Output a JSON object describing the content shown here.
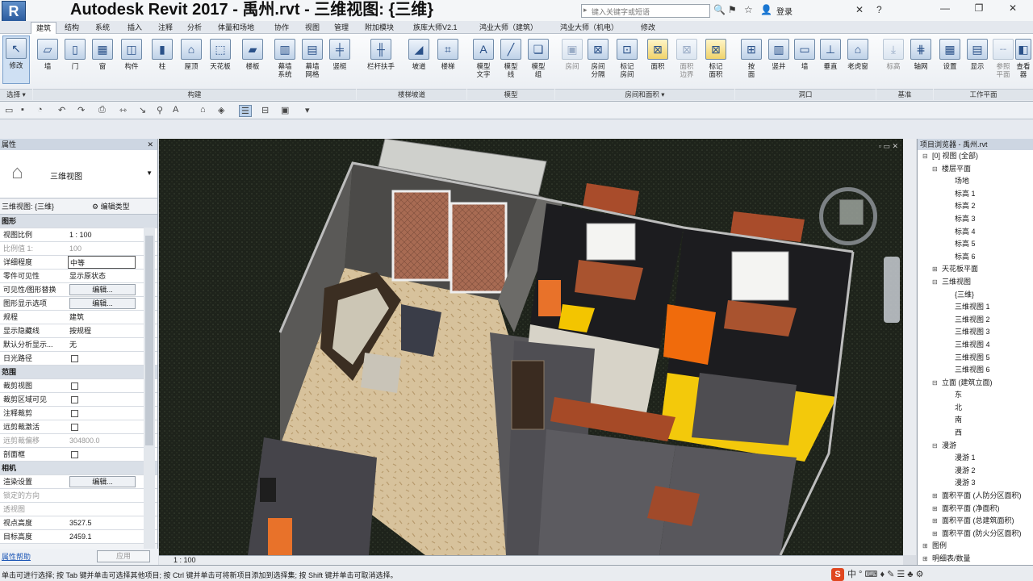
{
  "title_bar": {
    "app_logo": "R",
    "window_title": "Autodesk Revit 2017 -     禹州.rvt - 三维视图: {三维}",
    "search_placeholder": "键入关键字或短语",
    "sign_in": "登录",
    "window_controls": [
      "—",
      "❐",
      "✕"
    ]
  },
  "ribbon_tabs": [
    "建筑",
    "结构",
    "系统",
    "插入",
    "注释",
    "分析",
    "体量和场地",
    "协作",
    "视图",
    "管理",
    "附加模块",
    "族库大师V2.1",
    "鸿业大师（建筑）",
    "鸿业大师（机电）",
    "修改"
  ],
  "ribbon": {
    "modify_label": "修改",
    "build_buttons": [
      "墙",
      "门",
      "窗",
      "构件",
      "柱",
      "屋顶",
      "天花板",
      "楼板",
      "幕墙\n系统",
      "幕墙\n网格",
      "竖梃"
    ],
    "circulation_buttons": [
      "栏杆扶手",
      "坡道",
      "楼梯"
    ],
    "model_buttons": [
      "模型\n文字",
      "模型\n线",
      "模型\n组"
    ],
    "room_buttons": [
      "房间",
      "房间\n分隔",
      "标记\n房间",
      "面积",
      "面积\n边界",
      "标记\n面积"
    ],
    "opening_buttons": [
      "按\n面",
      "竖井",
      "墙",
      "垂直",
      "老虎窗"
    ],
    "datum_buttons": [
      "标高",
      "轴网"
    ],
    "workplane_buttons": [
      "设置",
      "显示",
      "参照\n平面",
      "查看器"
    ],
    "panels": {
      "select": "选择 ▾",
      "build": "构建",
      "circulation": "楼梯坡道",
      "model": "模型",
      "room": "房间和面积 ▾",
      "opening": "洞口",
      "datum": "基准",
      "workplane": "工作平面"
    }
  },
  "properties": {
    "header": "属性",
    "close": "✕",
    "type_name": "三维视图",
    "instance_selector": "三维视图: {三维}",
    "edit_type": "编辑类型",
    "rows": [
      {
        "k": "图形",
        "v": "",
        "kind": "grp"
      },
      {
        "k": "视图比例",
        "v": "1 : 100",
        "kind": "text"
      },
      {
        "k": "比例值 1:",
        "v": "100",
        "kind": "dis"
      },
      {
        "k": "详细程度",
        "v": "中等",
        "kind": "box"
      },
      {
        "k": "零件可见性",
        "v": "显示原状态",
        "kind": "text"
      },
      {
        "k": "可见性/图形替换",
        "v": "编辑...",
        "kind": "btn"
      },
      {
        "k": "图形显示选项",
        "v": "编辑...",
        "kind": "btn"
      },
      {
        "k": "规程",
        "v": "建筑",
        "kind": "text"
      },
      {
        "k": "显示隐藏线",
        "v": "按规程",
        "kind": "text"
      },
      {
        "k": "默认分析显示...",
        "v": "无",
        "kind": "text"
      },
      {
        "k": "日光路径",
        "v": "",
        "kind": "chk"
      },
      {
        "k": "范围",
        "v": "",
        "kind": "grp"
      },
      {
        "k": "裁剪视图",
        "v": "",
        "kind": "chk"
      },
      {
        "k": "裁剪区域可见",
        "v": "",
        "kind": "chk"
      },
      {
        "k": "注释裁剪",
        "v": "",
        "kind": "chk"
      },
      {
        "k": "远剪裁激活",
        "v": "",
        "kind": "chk"
      },
      {
        "k": "远剪裁偏移",
        "v": "304800.0",
        "kind": "dis"
      },
      {
        "k": "剖面框",
        "v": "",
        "kind": "chk"
      },
      {
        "k": "相机",
        "v": "",
        "kind": "grp"
      },
      {
        "k": "渲染设置",
        "v": "编辑...",
        "kind": "btn"
      },
      {
        "k": "锁定的方向",
        "v": "",
        "kind": "dis"
      },
      {
        "k": "透视图",
        "v": "",
        "kind": "dis"
      },
      {
        "k": "视点高度",
        "v": "3527.5",
        "kind": "text"
      },
      {
        "k": "目标高度",
        "v": "2459.1",
        "kind": "text"
      }
    ],
    "help_link": "属性帮助",
    "apply": "应用"
  },
  "viewport": {
    "scale": "1 : 100",
    "controls": "▫ ▭ ✕"
  },
  "project_browser": {
    "header": "项目浏览器 - 禹州.rvt",
    "nodes": [
      {
        "l": "[0] 视图 (全部)",
        "d": 0,
        "t": "⊟"
      },
      {
        "l": "楼层平面",
        "d": 1,
        "t": "⊟"
      },
      {
        "l": "场地",
        "d": 2,
        "t": ""
      },
      {
        "l": "标高 1",
        "d": 2,
        "t": ""
      },
      {
        "l": "标高 2",
        "d": 2,
        "t": ""
      },
      {
        "l": "标高 3",
        "d": 2,
        "t": ""
      },
      {
        "l": "标高 4",
        "d": 2,
        "t": ""
      },
      {
        "l": "标高 5",
        "d": 2,
        "t": ""
      },
      {
        "l": "标高 6",
        "d": 2,
        "t": ""
      },
      {
        "l": "天花板平面",
        "d": 1,
        "t": "⊞"
      },
      {
        "l": "三维视图",
        "d": 1,
        "t": "⊟"
      },
      {
        "l": "{三维}",
        "d": 2,
        "t": ""
      },
      {
        "l": "三维视图 1",
        "d": 2,
        "t": ""
      },
      {
        "l": "三维视图 2",
        "d": 2,
        "t": ""
      },
      {
        "l": "三维视图 3",
        "d": 2,
        "t": ""
      },
      {
        "l": "三维视图 4",
        "d": 2,
        "t": ""
      },
      {
        "l": "三维视图 5",
        "d": 2,
        "t": ""
      },
      {
        "l": "三维视图 6",
        "d": 2,
        "t": ""
      },
      {
        "l": "立面 (建筑立面)",
        "d": 1,
        "t": "⊟"
      },
      {
        "l": "东",
        "d": 2,
        "t": ""
      },
      {
        "l": "北",
        "d": 2,
        "t": ""
      },
      {
        "l": "南",
        "d": 2,
        "t": ""
      },
      {
        "l": "西",
        "d": 2,
        "t": ""
      },
      {
        "l": "漫游",
        "d": 1,
        "t": "⊟"
      },
      {
        "l": "漫游 1",
        "d": 2,
        "t": ""
      },
      {
        "l": "漫游 2",
        "d": 2,
        "t": ""
      },
      {
        "l": "漫游 3",
        "d": 2,
        "t": ""
      },
      {
        "l": "面积平面 (人防分区面积)",
        "d": 1,
        "t": "⊞"
      },
      {
        "l": "面积平面 (净面积)",
        "d": 1,
        "t": "⊞"
      },
      {
        "l": "面积平面 (总建筑面积)",
        "d": 1,
        "t": "⊞"
      },
      {
        "l": "面积平面 (防火分区面积)",
        "d": 1,
        "t": "⊞"
      },
      {
        "l": "图例",
        "d": 0,
        "t": "⊞"
      },
      {
        "l": "明细表/数量",
        "d": 0,
        "t": "⊞"
      }
    ]
  },
  "status_bar": {
    "text": "单击可进行选择; 按 Tab 键并单击可选择其他项目; 按 Ctrl 键并单击可将新项目添加到选择集; 按 Shift 键并单击可取消选择。",
    "ime": "中 ° ⌨ ♦ ✎ ☰ ♣ ⚙"
  }
}
